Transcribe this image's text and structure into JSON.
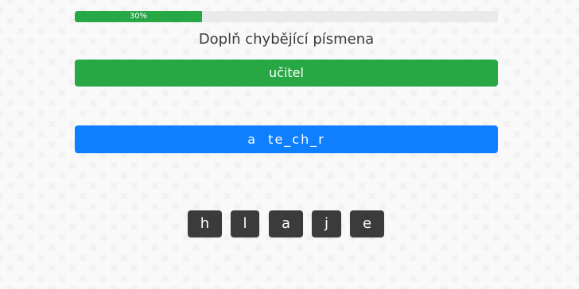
{
  "progress": {
    "percent": 30,
    "label": "30%",
    "fill_color": "#28a745",
    "track_color": "#e8eaec"
  },
  "instruction": "Doplň chybějící písmena",
  "answer": {
    "text": "učitel",
    "color": "#28a745"
  },
  "word": {
    "text": "a  te_ch_r",
    "color": "#0d7fff"
  },
  "letters": [
    "h",
    "l",
    "a",
    "j",
    "e"
  ]
}
